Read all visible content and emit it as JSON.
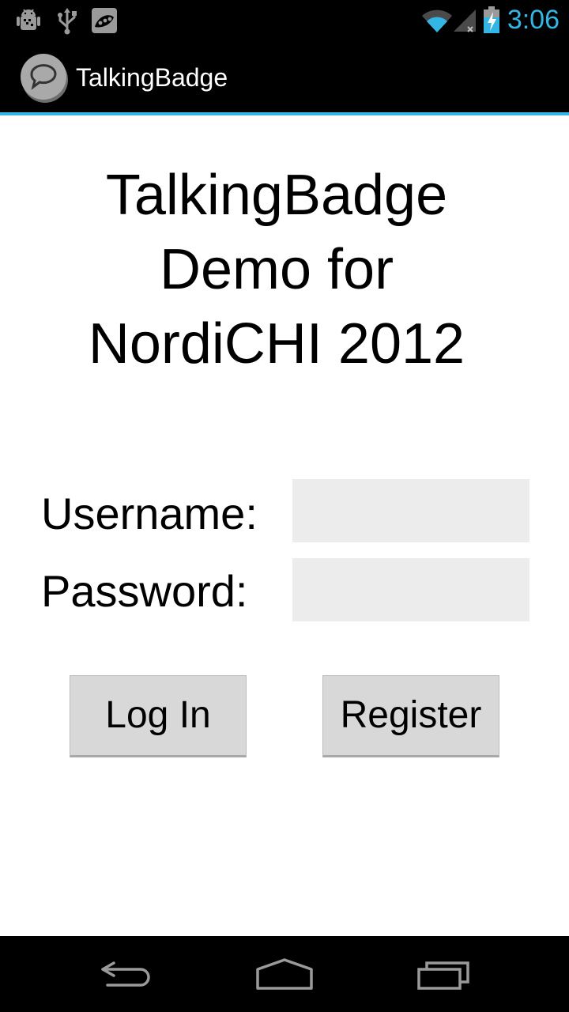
{
  "status_bar": {
    "time": "3:06",
    "icons": [
      "android-debug-icon",
      "usb-icon",
      "peas-app-icon",
      "wifi-icon",
      "signal-icon",
      "battery-charging-icon"
    ]
  },
  "action_bar": {
    "title": "TalkingBadge",
    "icon": "speech-bubble-icon"
  },
  "main": {
    "heading_lines": [
      "TalkingBadge",
      "Demo for",
      "NordiCHI 2012"
    ],
    "username_label": "Username:",
    "username_value": "",
    "password_label": "Password:",
    "password_value": "",
    "login_label": "Log In",
    "register_label": "Register"
  },
  "nav_bar": {
    "icons": [
      "back-icon",
      "home-icon",
      "recent-apps-icon"
    ]
  },
  "colors": {
    "accent": "#33b5e5",
    "bar_background": "#000000",
    "field_background": "#ececec",
    "button_background": "#d8d8d8"
  }
}
